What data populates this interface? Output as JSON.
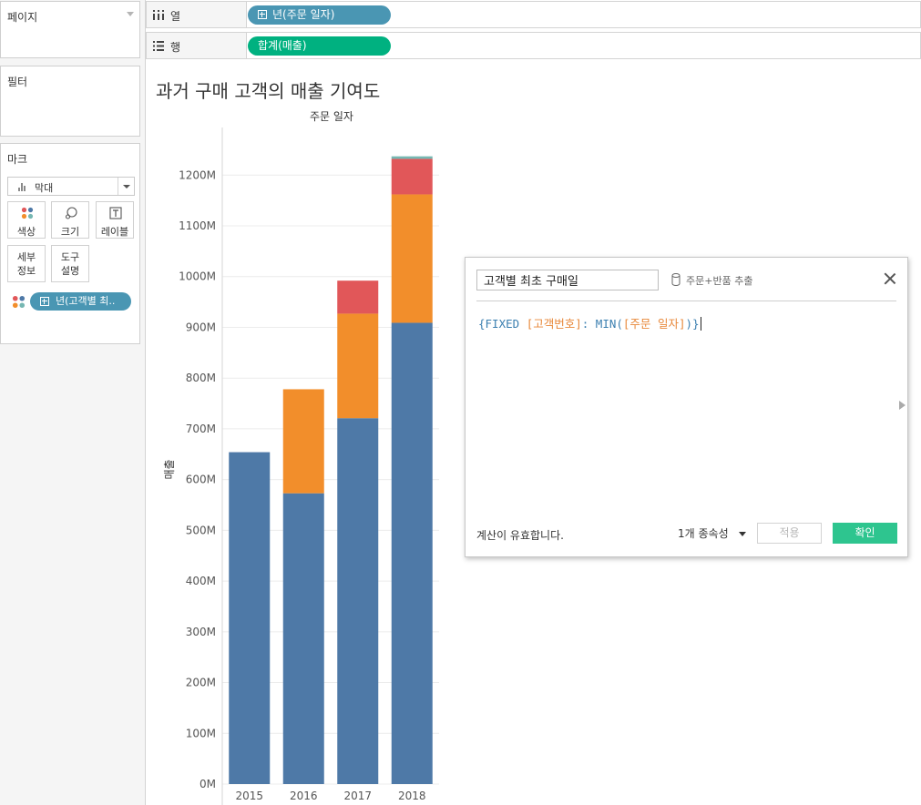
{
  "pages_card": {
    "title": "페이지"
  },
  "filters_card": {
    "title": "필터"
  },
  "marks_card": {
    "title": "마크",
    "mark_type": "막대",
    "buttons": {
      "color": "색상",
      "size": "크기",
      "label": "레이블",
      "detail": "세부 정보",
      "tooltip": "도구 설명"
    },
    "color_pill": "년(고객별 최.."
  },
  "shelves": {
    "columns": {
      "label": "열",
      "pill": "년(주문 일자)",
      "pill_color": "#4a96b3"
    },
    "rows": {
      "label": "행",
      "pill": "합계(매출)",
      "pill_color": "#00b180"
    }
  },
  "sheet": {
    "title": "과거 구매 고객의 매출 기여도"
  },
  "chart_data": {
    "type": "bar",
    "stacked": true,
    "title": "주문 일자",
    "xlabel": "",
    "ylabel": "매출",
    "categories": [
      "2015",
      "2016",
      "2017",
      "2018"
    ],
    "series": [
      {
        "color": "#4e79a7",
        "values": [
          654,
          573,
          721,
          909
        ]
      },
      {
        "color": "#f28e2b",
        "values": [
          0,
          205,
          206,
          253
        ]
      },
      {
        "color": "#e15759",
        "values": [
          0,
          0,
          65,
          70
        ]
      },
      {
        "color": "#76b7b2",
        "values": [
          0,
          0,
          0,
          5
        ]
      }
    ],
    "ylim": [
      0,
      1240
    ],
    "yticks": [
      "0M",
      "100M",
      "200M",
      "300M",
      "400M",
      "500M",
      "600M",
      "700M",
      "800M",
      "900M",
      "1000M",
      "1100M",
      "1200M"
    ],
    "grid": true
  },
  "dialog": {
    "name_value": "고객별 최초 구매일",
    "datasource": "주문+반품 추출",
    "formula": {
      "open": "{FIXED ",
      "field1": "[고객번호]",
      "mid": ": MIN(",
      "field2": "[주문 일자]",
      "close": ")}"
    },
    "status": "계산이 유효합니다.",
    "dependencies": "1개 종속성",
    "apply_label": "적용",
    "ok_label": "확인"
  }
}
